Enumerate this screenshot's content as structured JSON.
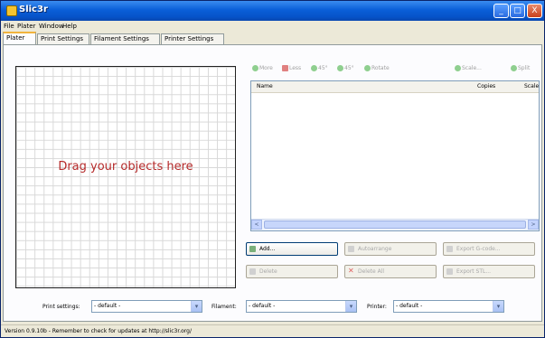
{
  "window": {
    "title": "Slic3r",
    "min": "_",
    "max": "□",
    "close": "X"
  },
  "menu": [
    "File",
    "Plater",
    "Window",
    "Help"
  ],
  "tabs": [
    "Plater",
    "Print Settings",
    "Filament Settings",
    "Printer Settings"
  ],
  "plater": {
    "canvas_message": "Drag your objects here",
    "toolbar": [
      "More",
      "Less",
      "45°",
      "45°",
      "Rotate",
      "Scale...",
      "Split"
    ],
    "list_columns": [
      "Name",
      "Copies",
      "Scale"
    ],
    "scroll_left": "<",
    "scroll_right": ">",
    "buttons": {
      "add": "Add...",
      "delete": "Delete",
      "autoarrange": "Autoarrange",
      "delete_all": "Delete All",
      "export_gcode": "Export G-code...",
      "export_stl": "Export STL..."
    },
    "print_settings_label": "Print settings:",
    "print_settings_value": "- default -",
    "filament_label": "Filament:",
    "filament_value": "- default -",
    "printer_label": "Printer:",
    "printer_value": "- default -"
  },
  "status": "Version 0.9.10b - Remember to check for updates at http://slic3r.org/"
}
